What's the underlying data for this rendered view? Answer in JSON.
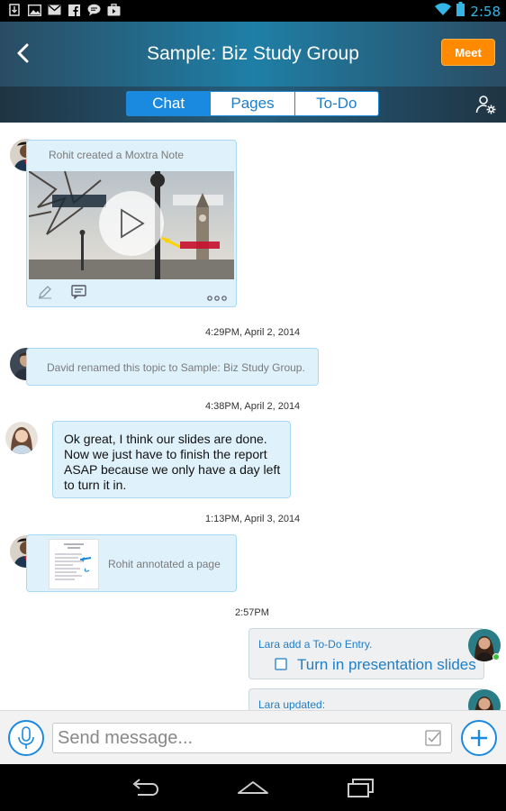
{
  "status_bar": {
    "time": "2:58",
    "notification_icons": [
      "download-icon",
      "image-icon",
      "gmail-icon",
      "facebook-icon",
      "chat-icon",
      "briefcase-icon"
    ]
  },
  "header": {
    "title": "Sample: Biz Study Group",
    "meet_label": "Meet"
  },
  "tabs": [
    {
      "label": "Chat",
      "active": true
    },
    {
      "label": "Pages",
      "active": false
    },
    {
      "label": "To-Do",
      "active": false
    }
  ],
  "feed": {
    "note_card": {
      "text": "Rohit created a Moxtra Note"
    },
    "ts1": "4:29PM, April 2, 2014",
    "rename": {
      "text": "David renamed this topic to Sample: Biz Study Group."
    },
    "ts2": "4:38PM, April 2, 2014",
    "message": {
      "text": "Ok great, I think our slides are done. Now we just have to finish the report ASAP because we only have a day left to turn it in."
    },
    "ts3": "1:13PM, April 3, 2014",
    "annotate": {
      "text": "Rohit annotated a page"
    },
    "ts4": "2:57PM",
    "todo": {
      "header": "Lara add a To-Do Entry.",
      "item": "Turn in presentation slides"
    },
    "update": {
      "header": "Lara updated:"
    }
  },
  "composer": {
    "placeholder": "Send message..."
  },
  "colors": {
    "accent": "#1a8ae0",
    "meet": "#ff8a00",
    "bubble": "#dff2fc",
    "bubble_border": "#a9d8f2"
  }
}
